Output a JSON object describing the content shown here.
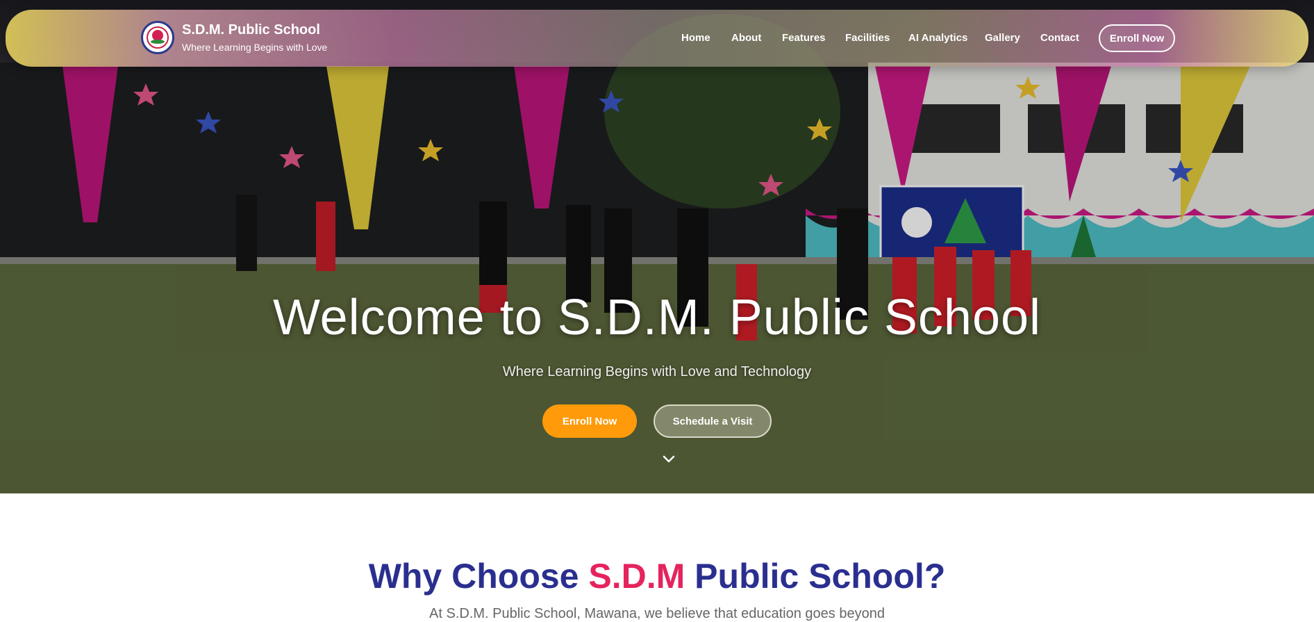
{
  "brand": {
    "name": "S.D.M. Public School",
    "tagline": "Where Learning Begins with Love"
  },
  "nav": {
    "links": [
      "Home",
      "About",
      "Features",
      "Facilities",
      "AI Analytics",
      "Gallery",
      "Contact"
    ],
    "cta": "Enroll Now"
  },
  "hero": {
    "title": "Welcome to S.D.M. Public School",
    "subtitle": "Where Learning Begins with Love and Technology",
    "primary_button": "Enroll Now",
    "secondary_button": "Schedule a Visit",
    "scroll_icon": "chevron-down-icon"
  },
  "why": {
    "title_part1": "Why Choose ",
    "title_accent": "S.D.M",
    "title_part2": " Public School?",
    "intro": "At S.D.M. Public School, Mawana, we believe that education goes beyond"
  },
  "colors": {
    "primary_orange": "#ff9a0a",
    "heading_navy": "#2a2f8f",
    "accent_pink": "#e5245e"
  }
}
